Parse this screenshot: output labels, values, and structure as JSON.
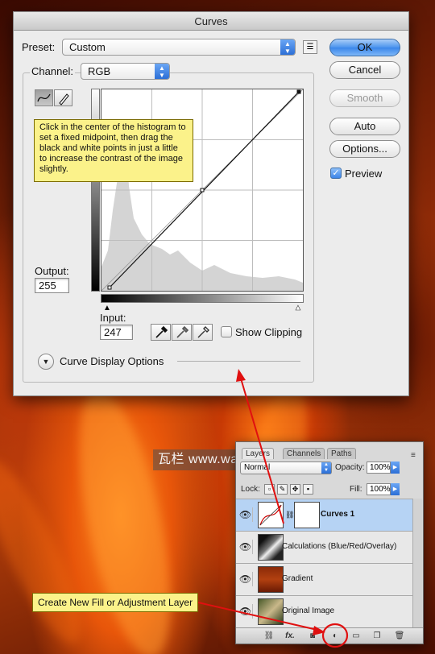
{
  "dialog": {
    "title": "Curves",
    "preset_label": "Preset:",
    "preset_value": "Custom",
    "channel_label": "Channel:",
    "channel_value": "RGB",
    "buttons": {
      "ok": "OK",
      "cancel": "Cancel",
      "smooth": "Smooth",
      "auto": "Auto",
      "options": "Options..."
    },
    "preview_label": "Preview",
    "preview_checked": true,
    "output_label": "Output:",
    "output_value": "255",
    "input_label": "Input:",
    "input_value": "247",
    "show_clipping_label": "Show Clipping",
    "curve_display_options": "Curve Display Options",
    "tooltip": "Click in the center of the histogram to set a fixed midpoint, then drag the black and white points in just a little to increase the contrast of the image slightly."
  },
  "layers_panel": {
    "tabs": [
      "Layers",
      "Channels",
      "Paths"
    ],
    "blend_mode": "Normal",
    "opacity_label": "Opacity:",
    "opacity_value": "100%",
    "lock_label": "Lock:",
    "fill_label": "Fill:",
    "fill_value": "100%",
    "layers": [
      {
        "name": "Curves 1",
        "selected": true
      },
      {
        "name": "Calculations (Blue/Red/Overlay)",
        "selected": false
      },
      {
        "name": "Gradient",
        "selected": false
      },
      {
        "name": "Original Image",
        "selected": false
      }
    ],
    "footer_fx": "fx."
  },
  "callout": "Create New Fill or Adjustment Layer",
  "watermark": "瓦栏 www.walanwalan.com",
  "colors": {
    "accent_blue": "#3a86ea",
    "tooltip_yellow": "#fbf28a",
    "arrow_red": "#e01010"
  }
}
